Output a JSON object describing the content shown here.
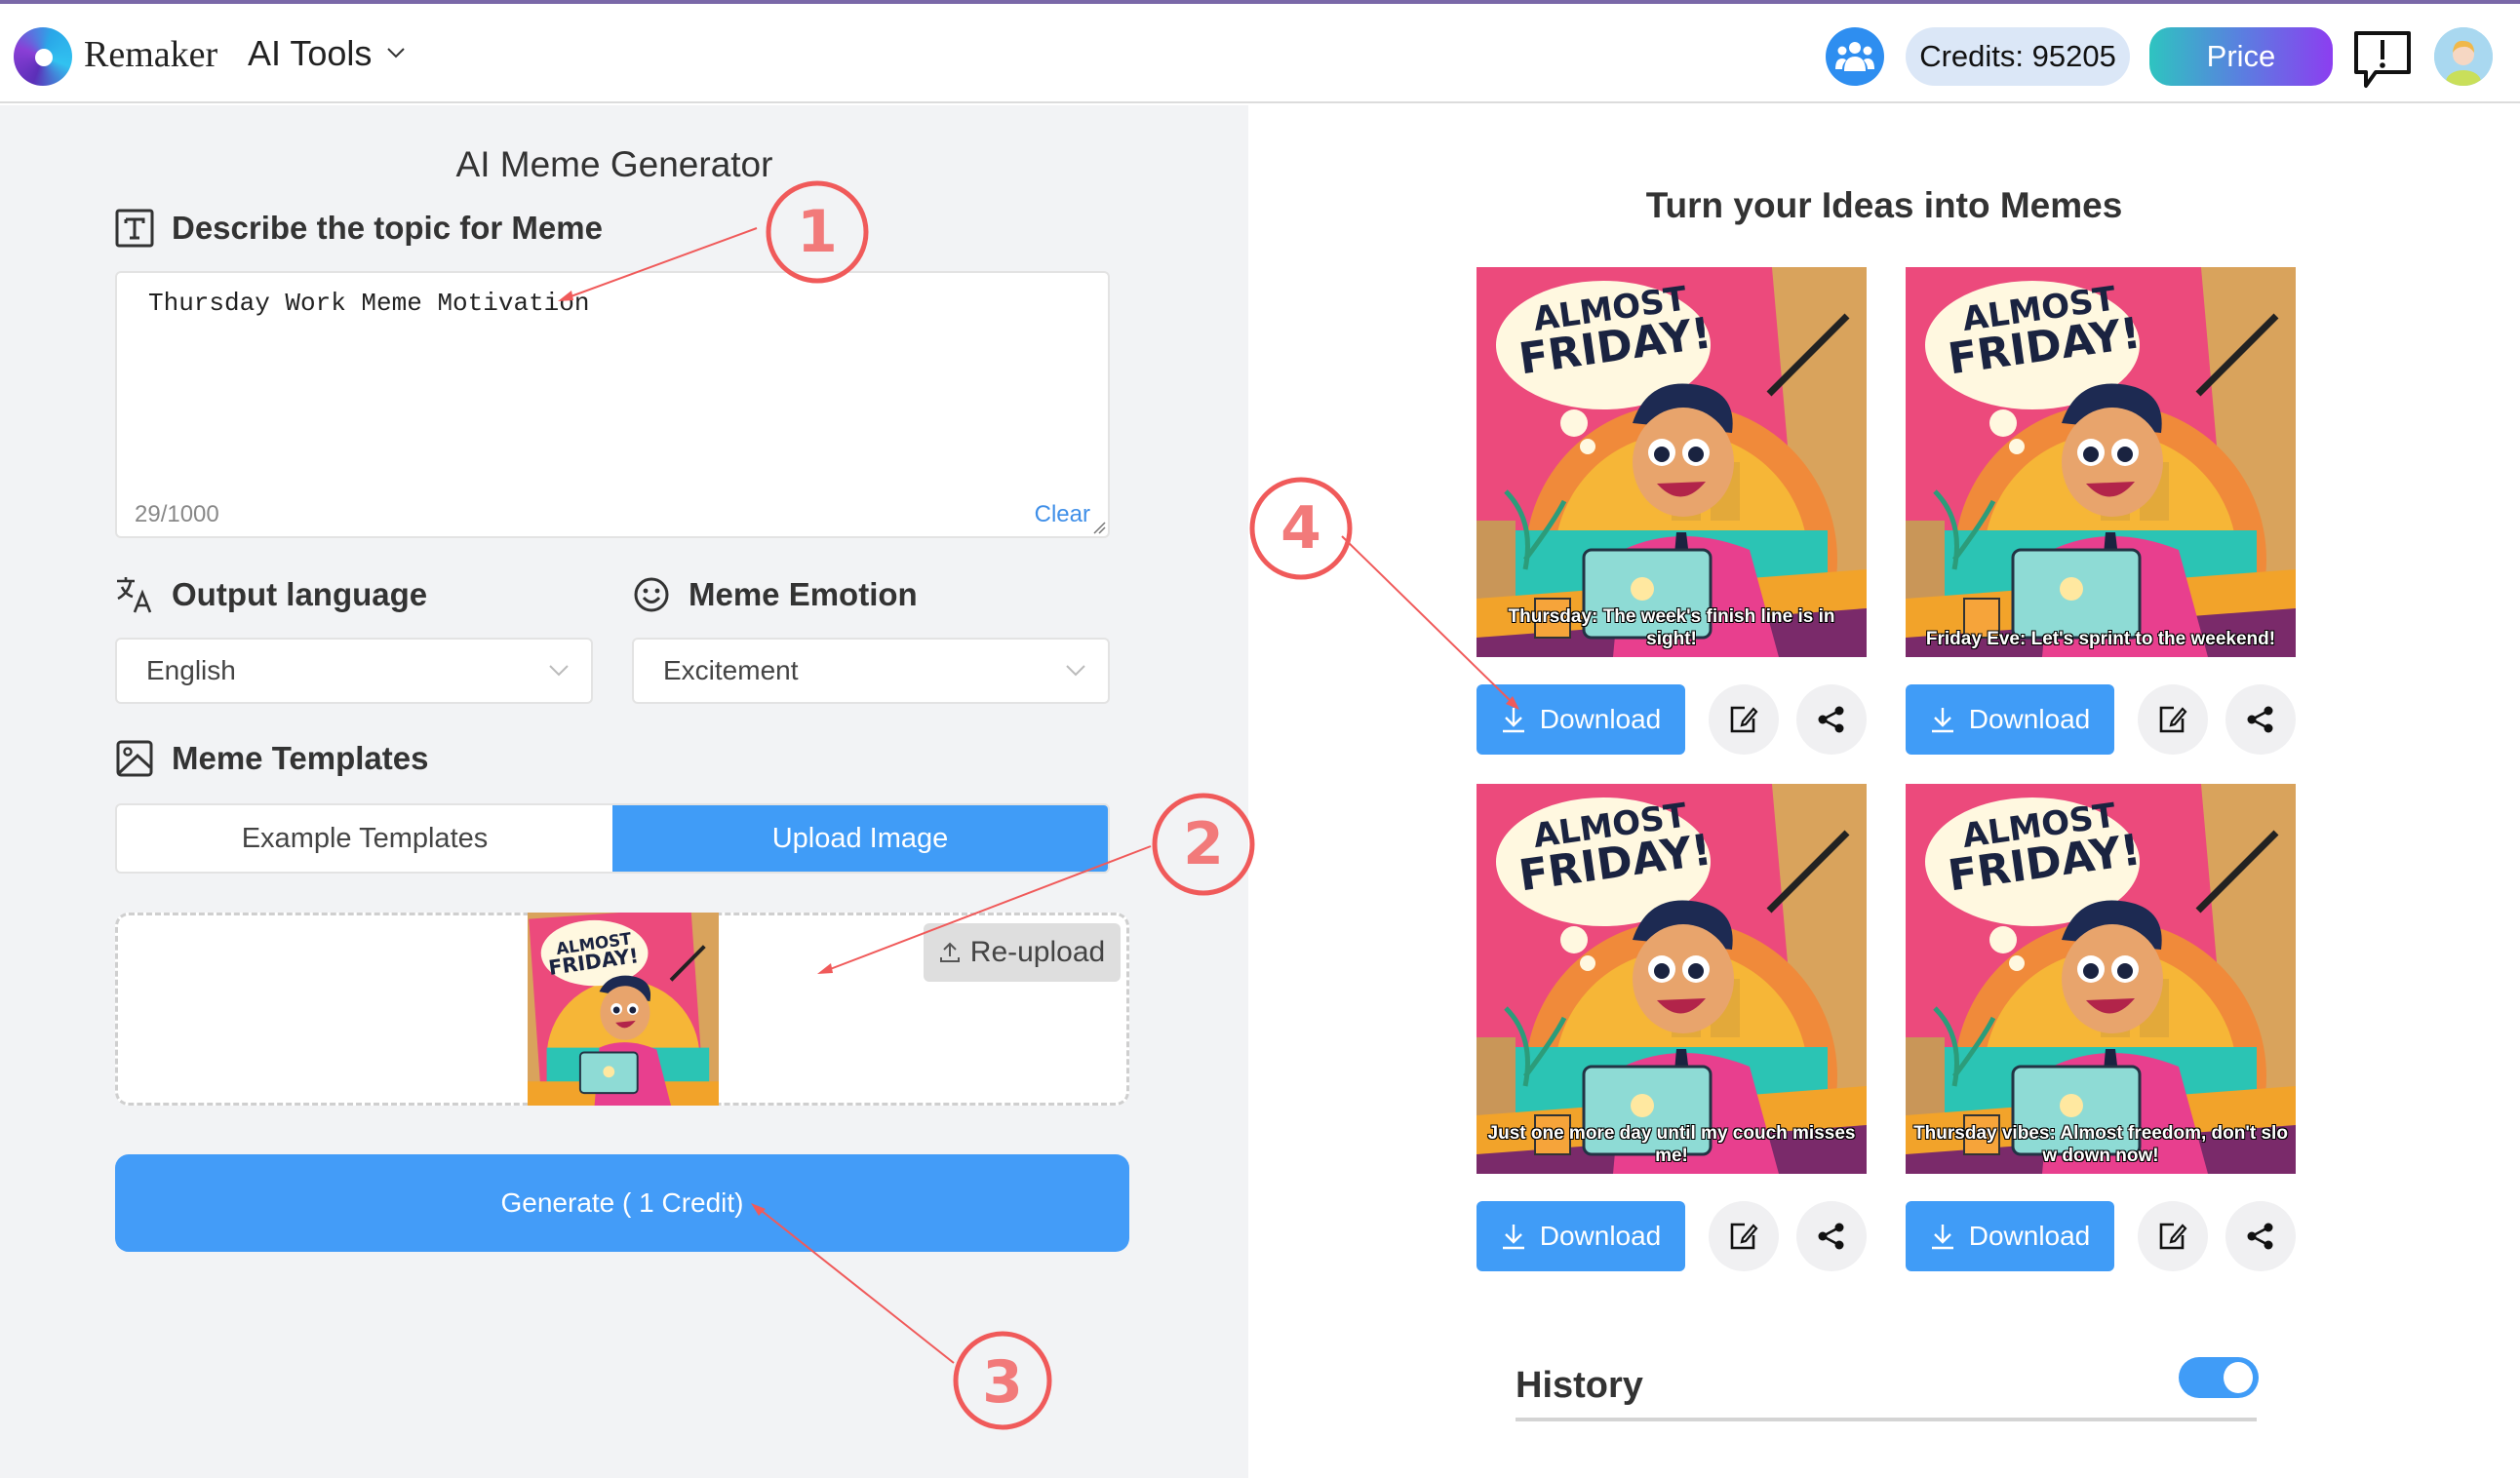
{
  "header": {
    "brand": "Remaker",
    "menu_label": "AI Tools",
    "credits_label": "Credits: 95205",
    "price_label": "Price"
  },
  "left": {
    "title": "AI Meme Generator",
    "topic_label": "Describe the topic for Meme",
    "topic_value": "Thursday Work Meme Motivation",
    "char_count": "29/1000",
    "clear_label": "Clear",
    "language_label": "Output language",
    "language_value": "English",
    "emotion_label": "Meme Emotion",
    "emotion_value": "Excitement",
    "templates_label": "Meme Templates",
    "tabs": [
      {
        "label": "Example Templates",
        "active": false
      },
      {
        "label": "Upload Image",
        "active": true
      }
    ],
    "reupload_label": "Re-upload",
    "generate_label": "Generate ( 1 Credit)"
  },
  "right": {
    "title": "Turn your Ideas into Memes",
    "memes": [
      {
        "headline_1": "ALMOST",
        "headline_2": "FRIDAY!",
        "caption": "Thursday: The week's finish line is in sight!",
        "download_label": "Download"
      },
      {
        "headline_1": "ALMOST",
        "headline_2": "FRIDAY!",
        "caption": "Friday Eve: Let's sprint to the weekend!",
        "download_label": "Download"
      },
      {
        "headline_1": "ALMOST",
        "headline_2": "FRIDAY!",
        "caption": "Just one more day until my couch misses me!",
        "download_label": "Download"
      },
      {
        "headline_1": "ALMOST",
        "headline_2": "FRIDAY!",
        "caption": "Thursday vibes: Almost freedom, don't slo w down now!",
        "download_label": "Download"
      }
    ],
    "history_label": "History",
    "history_toggle_on": true
  },
  "annotations": [
    "1",
    "2",
    "3",
    "4"
  ],
  "colors": {
    "accent": "#409cf7",
    "annotation": "#f05a5a",
    "panel_bg": "#f2f3f5"
  }
}
